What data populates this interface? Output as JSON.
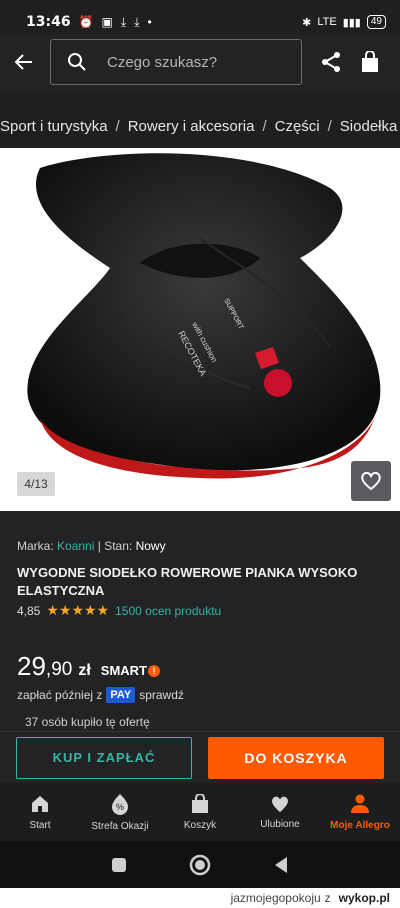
{
  "status_bar": {
    "time": "13:46",
    "network": "LTE",
    "battery": "49"
  },
  "header": {
    "search_placeholder": "Czego szukasz?"
  },
  "breadcrumb": [
    "Sport i turystyka",
    "Rowery i akcesoria",
    "Części",
    "Siodełka"
  ],
  "gallery": {
    "counter": "4/13",
    "saddle_text_1": "RECOTEKA",
    "saddle_text_2": "with cushion",
    "saddle_text_3": "SUPPORT"
  },
  "product": {
    "brand_label": "Marka:",
    "brand": "Koanni",
    "condition_label": "| Stan:",
    "condition": "Nowy",
    "title": "WYGODNE SIODEŁKO ROWEROWE PIANKA WYSOKO ELASTYCZNA",
    "rating": "4,85",
    "stars": "★★★★★",
    "rating_count": "1500 ocen produktu",
    "price_int": "29",
    "price_dec": ",90",
    "currency": "zł",
    "smart": "SMART",
    "pay_before": "zapłać później z",
    "pay_badge": "PAY",
    "pay_after": "sprawdź",
    "bought": "37 osób kupiło tę ofertę"
  },
  "actions": {
    "buy_label": "KUP I ZAPŁAĆ",
    "cart_label": "DO KOSZYKA"
  },
  "bottom_nav": [
    {
      "label": "Start"
    },
    {
      "label": "Strefa Okazji"
    },
    {
      "label": "Koszyk"
    },
    {
      "label": "Ulubione"
    },
    {
      "label": "Moje Allegro"
    }
  ],
  "watermark": {
    "user": "jazmojegopokoju",
    "sep": "z",
    "site": "wykop.pl"
  },
  "colors": {
    "accent_teal": "#35b6a6",
    "accent_orange": "#ff5a00",
    "background": "#222325"
  }
}
